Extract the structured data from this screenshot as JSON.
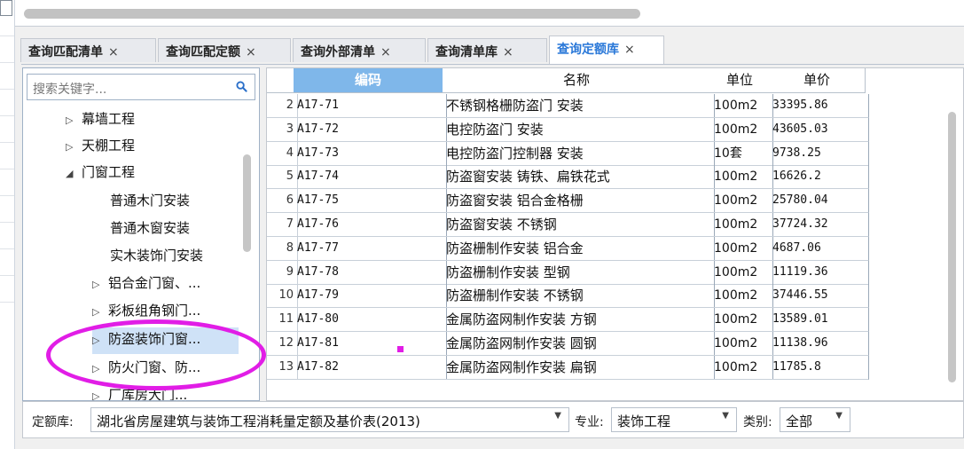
{
  "tabs": [
    {
      "label": "查询匹配清单",
      "close": "×"
    },
    {
      "label": "查询匹配定额",
      "close": "×"
    },
    {
      "label": "查询外部清单",
      "close": "×"
    },
    {
      "label": "查询清单库",
      "close": "×"
    },
    {
      "label": "查询定额库",
      "close": "×",
      "active": true
    }
  ],
  "sidebar": {
    "search_placeholder": "搜索关键字...",
    "tree": [
      {
        "label": "幕墙工程",
        "arrow": "▷"
      },
      {
        "label": "天棚工程",
        "arrow": "▷"
      },
      {
        "label": "门窗工程",
        "arrow": "◢"
      },
      {
        "label": "普通木门安装",
        "arrow": ""
      },
      {
        "label": "普通木窗安装",
        "arrow": ""
      },
      {
        "label": "实木装饰门安装",
        "arrow": ""
      },
      {
        "label": "铝合金门窗、...",
        "arrow": "▷"
      },
      {
        "label": "彩板组角钢门...",
        "arrow": "▷"
      },
      {
        "label": "防盗装饰门窗...",
        "arrow": "▷",
        "selected": true
      },
      {
        "label": "防火门窗、防...",
        "arrow": "▷"
      },
      {
        "label": "厂库房大门...",
        "arrow": "▷"
      }
    ]
  },
  "grid": {
    "headers": {
      "code": "编码",
      "name": "名称",
      "unit": "单位",
      "price": "单价"
    },
    "rows": [
      {
        "n": "2",
        "code": "A17-71",
        "name": "不锈钢格栅防盗门 安装",
        "unit": "100m2",
        "price": "33395.86"
      },
      {
        "n": "3",
        "code": "A17-72",
        "name": "电控防盗门 安装",
        "unit": "100m2",
        "price": "43605.03"
      },
      {
        "n": "4",
        "code": "A17-73",
        "name": "电控防盗门控制器 安装",
        "unit": "10套",
        "price": "9738.25"
      },
      {
        "n": "5",
        "code": "A17-74",
        "name": "防盗窗安装 铸铁、扁铁花式",
        "unit": "100m2",
        "price": "16626.2"
      },
      {
        "n": "6",
        "code": "A17-75",
        "name": "防盗窗安装 铝合金格栅",
        "unit": "100m2",
        "price": "25780.04"
      },
      {
        "n": "7",
        "code": "A17-76",
        "name": "防盗窗安装 不锈钢",
        "unit": "100m2",
        "price": "37724.32"
      },
      {
        "n": "8",
        "code": "A17-77",
        "name": "防盗栅制作安装 铝合金",
        "unit": "100m2",
        "price": "4687.06"
      },
      {
        "n": "9",
        "code": "A17-78",
        "name": "防盗栅制作安装 型钢",
        "unit": "100m2",
        "price": "11119.36"
      },
      {
        "n": "10",
        "code": "A17-79",
        "name": "防盗栅制作安装 不锈钢",
        "unit": "100m2",
        "price": "37446.55"
      },
      {
        "n": "11",
        "code": "A17-80",
        "name": "金属防盗网制作安装 方钢",
        "unit": "100m2",
        "price": "13589.01"
      },
      {
        "n": "12",
        "code": "A17-81",
        "name": "金属防盗网制作安装 圆钢",
        "unit": "100m2",
        "price": "11138.96"
      },
      {
        "n": "13",
        "code": "A17-82",
        "name": "金属防盗网制作安装 扁钢",
        "unit": "100m2",
        "price": "11785.8"
      }
    ]
  },
  "bottom": {
    "library_label": "定额库:",
    "library_value": "湖北省房屋建筑与装饰工程消耗量定额及基价表(2013)",
    "specialty_label": "专业:",
    "specialty_value": "装饰工程",
    "category_label": "类别:",
    "category_value": "全部"
  },
  "annotation_color": "#e11de6"
}
